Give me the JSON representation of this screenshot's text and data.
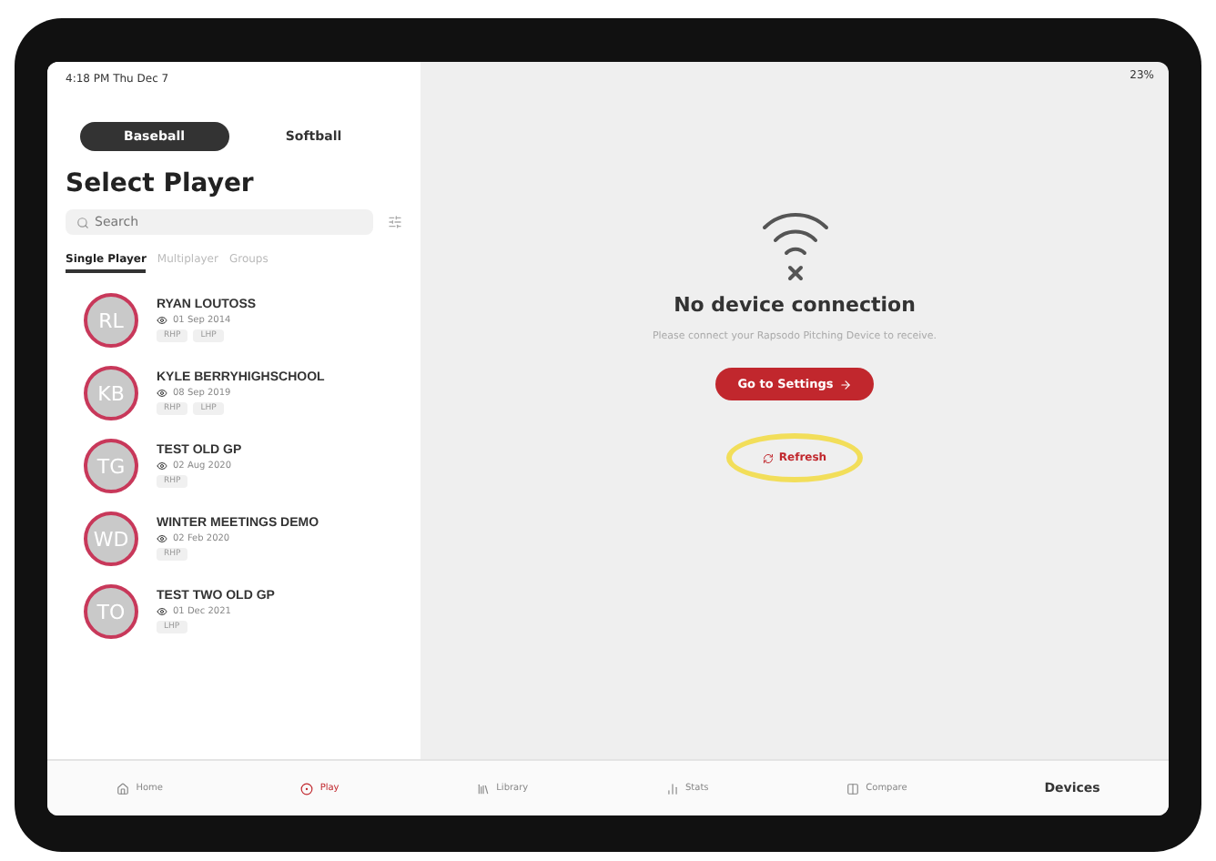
{
  "status_bar": {
    "time": "4:18 PM  Thu Dec 7",
    "battery": "23%"
  },
  "sport_toggle": [
    {
      "label": "Baseball",
      "selected": true
    },
    {
      "label": "Softball",
      "selected": false
    }
  ],
  "title": "Select Player",
  "search": {
    "placeholder": "Search"
  },
  "mode_tabs": [
    {
      "label": "Single Player",
      "selected": true
    },
    {
      "label": "Multiplayer",
      "selected": false
    },
    {
      "label": "Groups",
      "selected": false
    }
  ],
  "players": [
    {
      "initials": "RL",
      "name": "RYAN LOUTOSS",
      "date": "01 Sep 2014",
      "tags": [
        "RHP",
        "LHP"
      ]
    },
    {
      "initials": "KB",
      "name": "KYLE BERRYHIGHSCHOOL",
      "date": "08 Sep 2019",
      "tags": [
        "RHP",
        "LHP"
      ]
    },
    {
      "initials": "TG",
      "name": "TEST OLD GP",
      "date": "02 Aug 2020",
      "tags": [
        "RHP"
      ]
    },
    {
      "initials": "WD",
      "name": "WINTER MEETINGS DEMO",
      "date": "02 Feb 2020",
      "tags": [
        "RHP"
      ]
    },
    {
      "initials": "TO",
      "name": "TEST TWO OLD GP",
      "date": "01 Dec 2021",
      "tags": [
        "LHP"
      ]
    }
  ],
  "empty_state": {
    "title": "No device connection",
    "message": "Please connect your Rapsodo Pitching Device to receive.",
    "primary_button": "Go to Settings",
    "secondary_button": "Refresh",
    "highlighted": true
  },
  "tab_bar": [
    {
      "label": "Home",
      "selected": false
    },
    {
      "label": "Play",
      "selected": true
    },
    {
      "label": "Library",
      "selected": false
    },
    {
      "label": "Stats",
      "selected": false
    },
    {
      "label": "Compare",
      "selected": false
    },
    {
      "label": "Devices",
      "selected": false
    }
  ]
}
